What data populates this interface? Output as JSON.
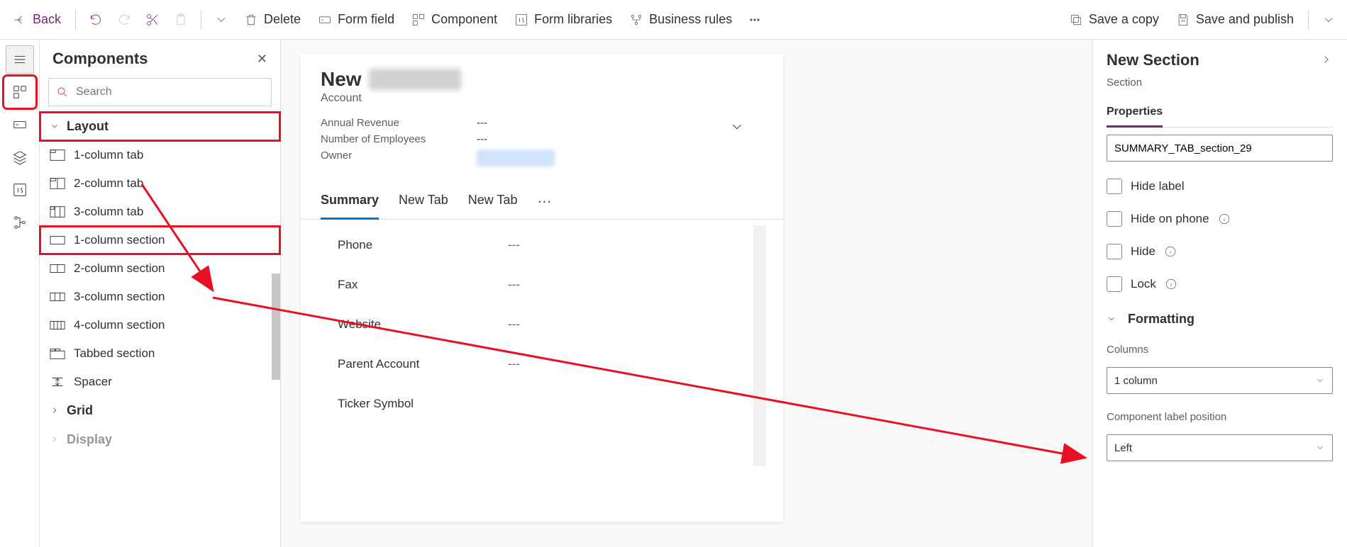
{
  "toolbar": {
    "back": "Back",
    "delete": "Delete",
    "formField": "Form field",
    "component": "Component",
    "formLibraries": "Form libraries",
    "businessRules": "Business rules",
    "saveCopy": "Save a copy",
    "savePublish": "Save and publish"
  },
  "components": {
    "title": "Components",
    "searchPlaceholder": "Search",
    "groups": {
      "layout": "Layout",
      "grid": "Grid",
      "display": "Display"
    },
    "layoutItems": [
      "1-column tab",
      "2-column tab",
      "3-column tab",
      "1-column section",
      "2-column section",
      "3-column section",
      "4-column section",
      "Tabbed section",
      "Spacer"
    ]
  },
  "form": {
    "title": "New",
    "entity": "Account",
    "headerFields": [
      {
        "label": "Annual Revenue",
        "value": "---"
      },
      {
        "label": "Number of Employees",
        "value": "---"
      },
      {
        "label": "Owner",
        "value": ""
      }
    ],
    "tabs": [
      "Summary",
      "New Tab",
      "New Tab"
    ],
    "detailFields": [
      {
        "label": "Phone",
        "value": "---"
      },
      {
        "label": "Fax",
        "value": "---"
      },
      {
        "label": "Website",
        "value": "---"
      },
      {
        "label": "Parent Account",
        "value": "---"
      },
      {
        "label": "Ticker Symbol",
        "value": ""
      }
    ]
  },
  "props": {
    "title": "New Section",
    "sub": "Section",
    "pivot": "Properties",
    "nameValue": "SUMMARY_TAB_section_29",
    "checks": [
      "Hide label",
      "Hide on phone",
      "Hide",
      "Lock"
    ],
    "formatting": "Formatting",
    "columnsLabel": "Columns",
    "columnsValue": "1 column",
    "labelPosLabel": "Component label position",
    "labelPosValue": "Left"
  }
}
